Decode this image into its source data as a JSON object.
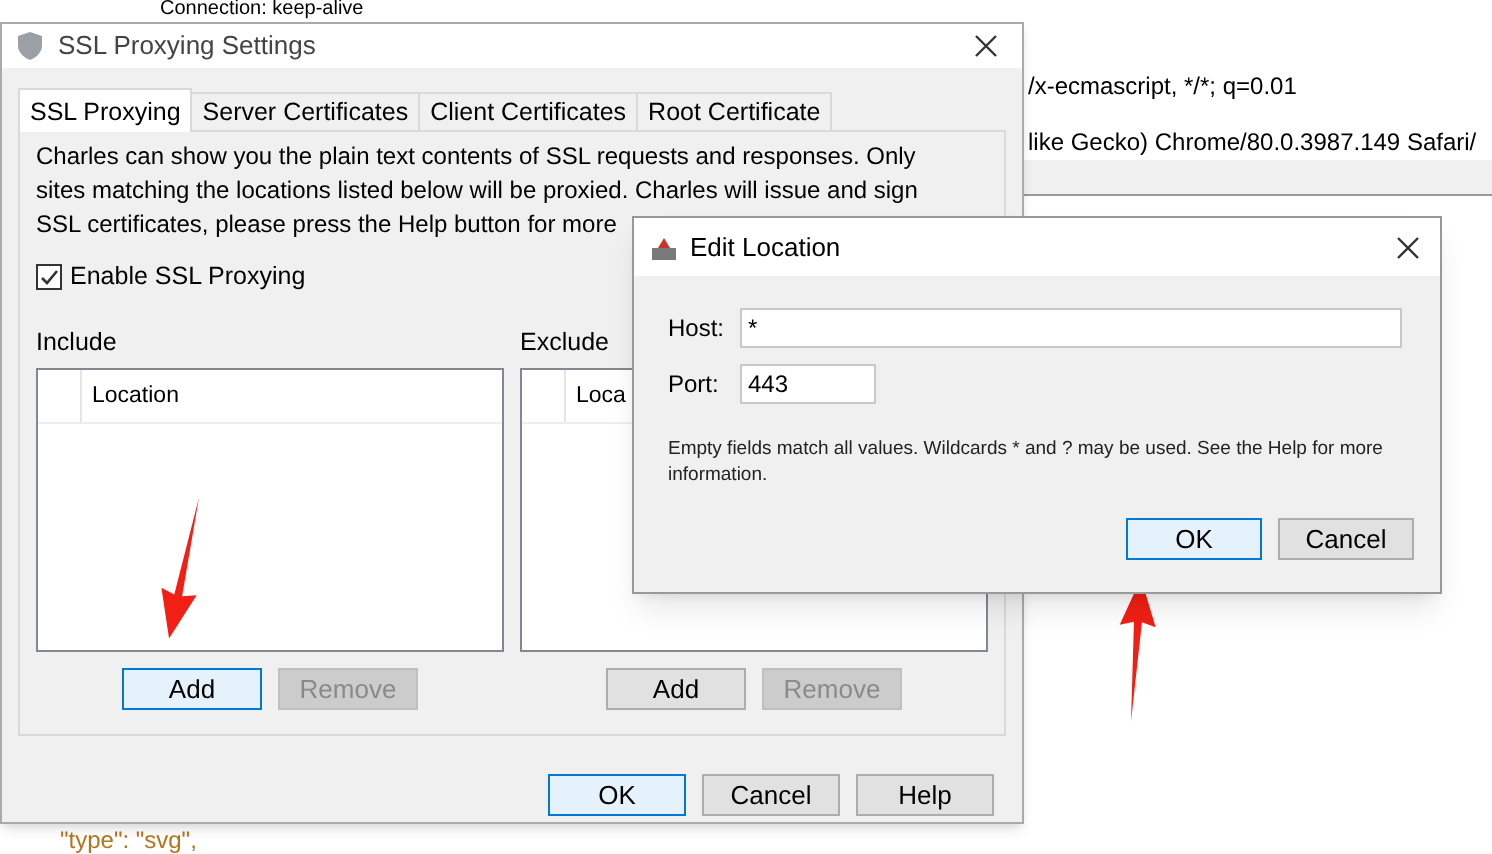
{
  "background_text": [
    {
      "text": "Connection: keep-alive",
      "kind": "plain"
    },
    {
      "text": "/x-ecmascript, */*; q=0.01",
      "kind": "plain"
    },
    {
      "text": "like Gecko) Chrome/80.0.3987.149 Safari/",
      "kind": "plain"
    },
    {
      "text": "\"type\": \"svg\",",
      "kind": "code"
    }
  ],
  "main_dialog": {
    "title": "SSL Proxying Settings",
    "tabs": [
      {
        "label": "SSL Proxying",
        "selected": true
      },
      {
        "label": "Server Certificates",
        "selected": false
      },
      {
        "label": "Client Certificates",
        "selected": false
      },
      {
        "label": "Root Certificate",
        "selected": false
      }
    ],
    "description": "Charles can show you the plain text contents of SSL requests and responses. Only sites matching the locations listed below will be proxied. Charles will issue and sign SSL certificates, please press the Help button for more",
    "enable_checkbox": {
      "label": "Enable SSL Proxying",
      "checked": true
    },
    "lists": [
      {
        "label": "Include",
        "column_header": "Location",
        "buttons": [
          {
            "label": "Add",
            "disabled": false,
            "focused": true
          },
          {
            "label": "Remove",
            "disabled": true,
            "focused": false
          }
        ]
      },
      {
        "label": "Exclude",
        "column_header": "Loca",
        "buttons": [
          {
            "label": "Add",
            "disabled": false,
            "focused": false
          },
          {
            "label": "Remove",
            "disabled": true,
            "focused": false
          }
        ]
      }
    ],
    "buttons": [
      {
        "label": "OK",
        "focused": true
      },
      {
        "label": "Cancel",
        "focused": false
      },
      {
        "label": "Help",
        "focused": false
      }
    ]
  },
  "edit_location": {
    "title": "Edit Location",
    "fields": [
      {
        "label": "Host:",
        "value": "*",
        "kind": "wide"
      },
      {
        "label": "Port:",
        "value": "443",
        "kind": "narrow"
      }
    ],
    "note": "Empty fields match all values. Wildcards * and ? may be used. See the Help for more information.",
    "buttons": [
      {
        "label": "OK",
        "focused": true
      },
      {
        "label": "Cancel",
        "focused": false
      }
    ]
  }
}
